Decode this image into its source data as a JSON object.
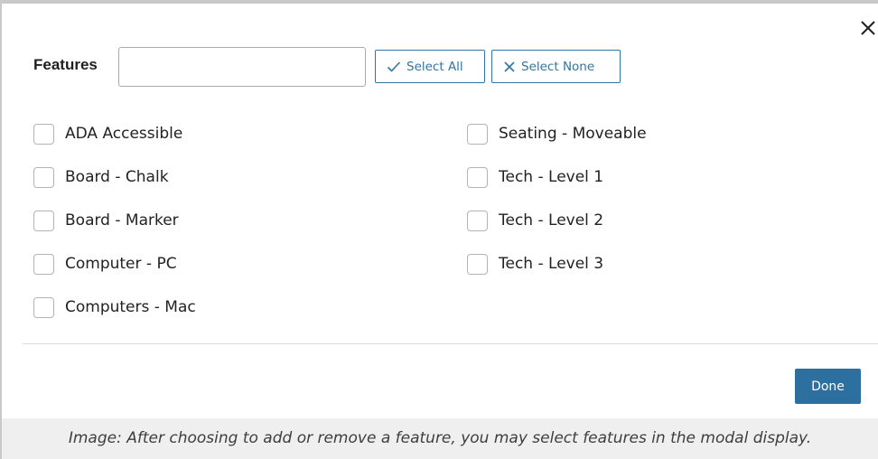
{
  "modal": {
    "features_label": "Features",
    "search_value": "",
    "select_all_label": "Select All",
    "select_none_label": "Select None",
    "done_label": "Done",
    "accent_color": "#2f74a4",
    "close_icon": "close-icon",
    "options_left": [
      {
        "label": "ADA Accessible",
        "checked": false
      },
      {
        "label": "Board - Chalk",
        "checked": false
      },
      {
        "label": "Board - Marker",
        "checked": false
      },
      {
        "label": "Computer - PC",
        "checked": false
      },
      {
        "label": "Computers - Mac",
        "checked": false
      }
    ],
    "options_right": [
      {
        "label": "Seating - Moveable",
        "checked": false
      },
      {
        "label": "Tech - Level 1",
        "checked": false
      },
      {
        "label": "Tech - Level 2",
        "checked": false
      },
      {
        "label": "Tech - Level 3",
        "checked": false
      }
    ]
  },
  "caption": "Image: After choosing to add or remove a feature, you may select features in the modal display."
}
